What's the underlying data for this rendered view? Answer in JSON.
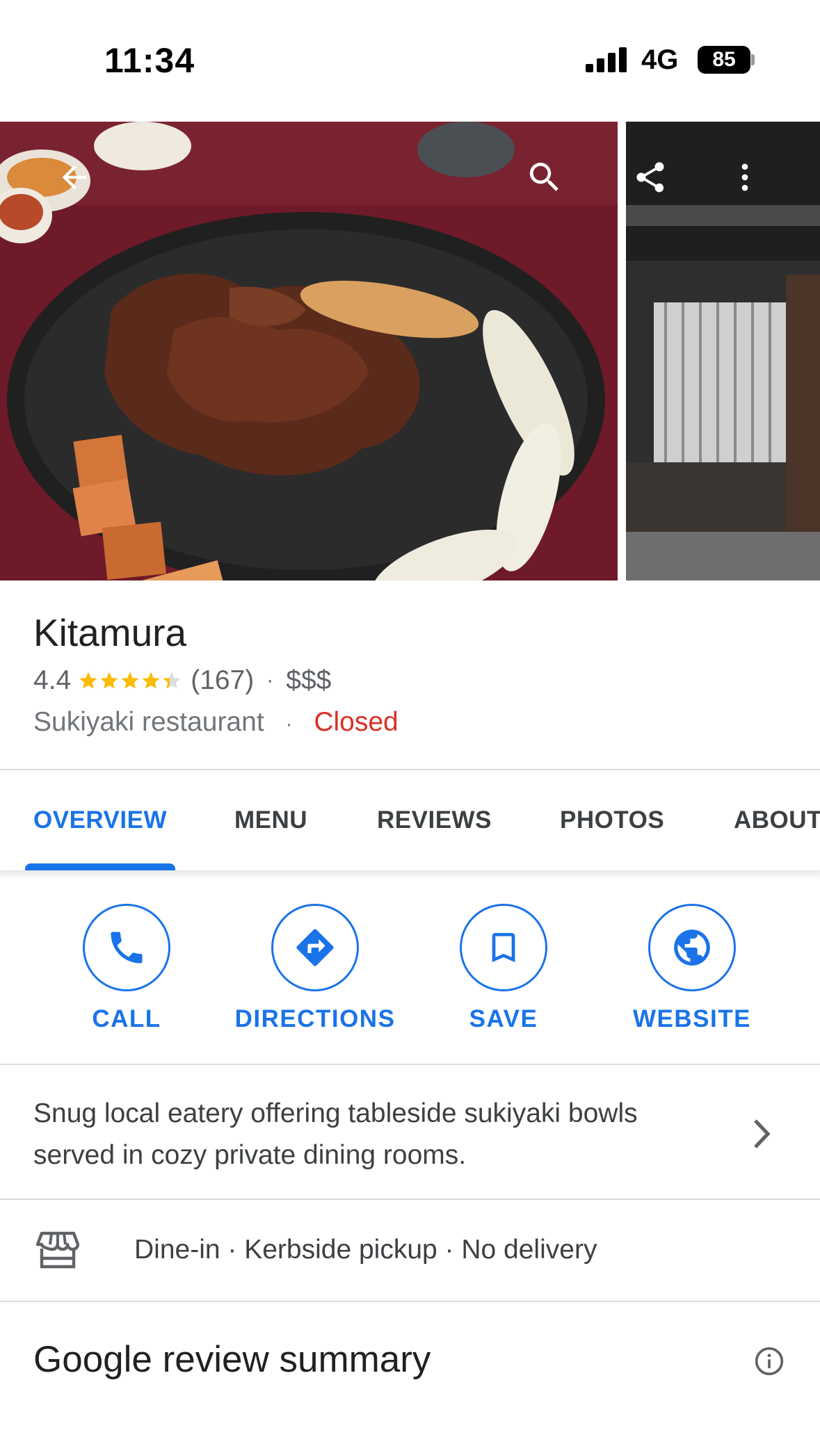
{
  "status_bar": {
    "time": "11:34",
    "network": "4G",
    "battery": "85"
  },
  "place": {
    "name": "Kitamura",
    "rating": "4.4",
    "stars_value": 4.4,
    "review_count": "(167)",
    "price": "$$$",
    "category": "Sukiyaki restaurant",
    "status": "Closed"
  },
  "tabs": [
    {
      "label": "OVERVIEW",
      "active": true
    },
    {
      "label": "MENU"
    },
    {
      "label": "REVIEWS"
    },
    {
      "label": "PHOTOS"
    },
    {
      "label": "ABOUT"
    }
  ],
  "actions": [
    {
      "label": "CALL",
      "icon": "phone-icon"
    },
    {
      "label": "DIRECTIONS",
      "icon": "directions-icon"
    },
    {
      "label": "SAVE",
      "icon": "bookmark-icon"
    },
    {
      "label": "WEBSITE",
      "icon": "globe-icon"
    }
  ],
  "description": "Snug local eatery offering tableside sukiyaki bowls served in cozy private dining rooms.",
  "service_options": "Dine-in · Kerbside pickup · No delivery",
  "review_summary": {
    "title": "Google review summary"
  },
  "colors": {
    "accent": "#1a73e8",
    "star": "#fbbc04",
    "closed": "#d93025"
  }
}
